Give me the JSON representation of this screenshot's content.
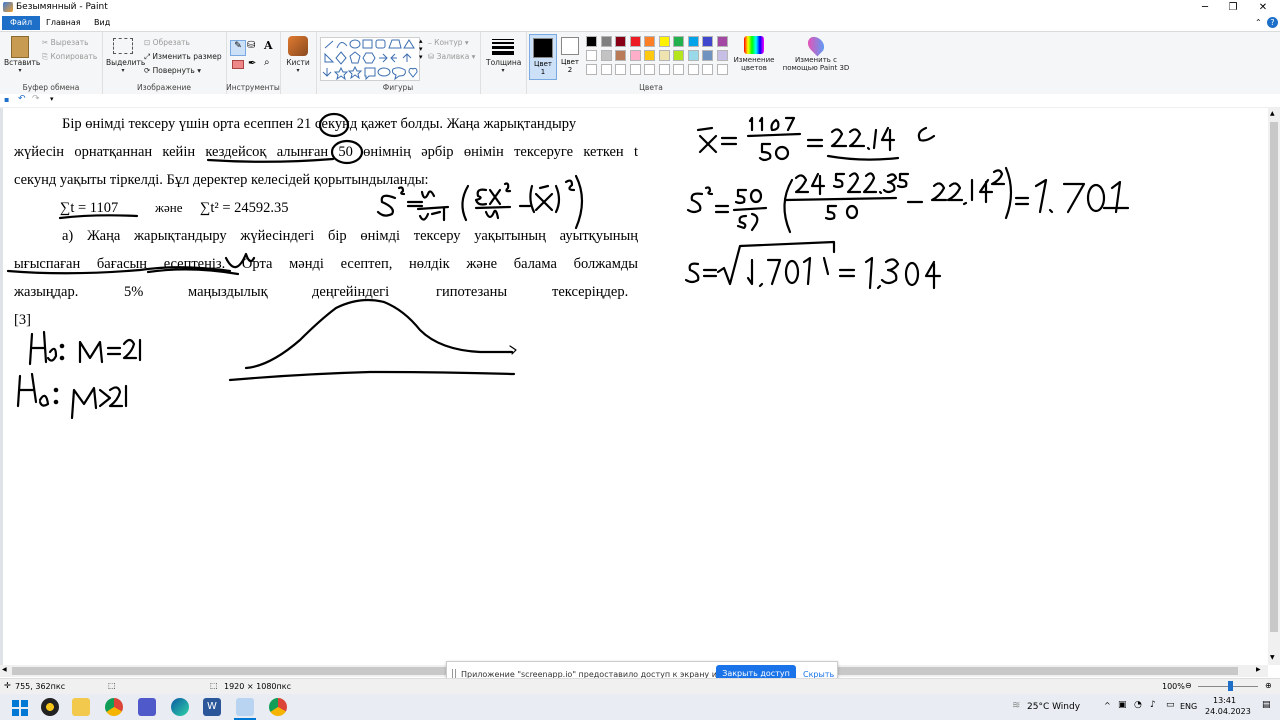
{
  "window": {
    "title": "Безымянный - Paint",
    "minimize": "─",
    "maximize": "❐",
    "close": "✕"
  },
  "tabs": [
    "Файл",
    "Главная",
    "Вид"
  ],
  "ribbon": {
    "clipboard": {
      "paste": "Вставить",
      "cut": "Вырезать",
      "copy": "Копировать",
      "label": "Буфер обмена"
    },
    "image": {
      "select": "Выделить",
      "crop": "Обрезать",
      "resize": "Изменить размер",
      "rotate": "Повернуть",
      "label": "Изображение"
    },
    "tools": {
      "label": "Инструменты",
      "brushes": "Кисти"
    },
    "shapes": {
      "label": "Фигуры",
      "outline": "Контур",
      "fill": "Заливка"
    },
    "size": {
      "label": "Толщина"
    },
    "colors": {
      "color1": "Цвет\n1",
      "color2": "Цвет\n2",
      "edit": "Изменение цветов",
      "paint3d": "Изменить с помощью Paint 3D",
      "label": "Цвета",
      "palette_row1": [
        "#000000",
        "#7f7f7f",
        "#880015",
        "#ed1c24",
        "#ff7f27",
        "#fff200",
        "#22b14c",
        "#00a2e8",
        "#3f48cc",
        "#a349a4"
      ],
      "palette_row2": [
        "#ffffff",
        "#c3c3c3",
        "#b97a57",
        "#ffaec9",
        "#ffc90e",
        "#efe4b0",
        "#b5e61d",
        "#99d9ea",
        "#7092be",
        "#c8bfe7"
      ]
    }
  },
  "document": {
    "line1": "Бір өнімді тексеру үшін орта есеппен 21 секунд қажет болды. Жаңа жарықтандыру",
    "line2": "жүйесін орнатқаннан кейін кездейсоқ алынған 50 өнімнің әрбір өнімін тексеруге кеткен t",
    "line3": "секунд уақыты тіркелді. Бұл деректер келесідей қорытындыланды:",
    "formula1": "∑t = 1107",
    "and": "және",
    "formula2": "∑t² = 24592.35",
    "line4": "а) Жаңа жарықтандыру жүйесіндегі бір өнімді тексеру уақытының ауытқуының",
    "line5": "ығыспаған бағасын есептеңіз. Орта мәнді есептеп, нөлдік және балама болжамды",
    "line6a": "жазыңдар.",
    "line6b": "5%",
    "line6c": "маңыздылық",
    "line6d": "деңгейіндегі",
    "line6e": "гипотезаны",
    "line6f": "тексеріңдер.",
    "line7": "[3]"
  },
  "notification": {
    "message": "Приложение \"screenapp.io\" предоставило доступ к экрану и аудио.",
    "button": "Закрыть доступ",
    "hide": "Скрыть"
  },
  "status": {
    "position": "755, 362пкс",
    "size": "1920 × 1080пкс",
    "zoom": "100%"
  },
  "taskbar": {
    "weather": "25°C  Windy",
    "lang": "ENG",
    "time": "13:41",
    "date": "24.04.2023"
  }
}
